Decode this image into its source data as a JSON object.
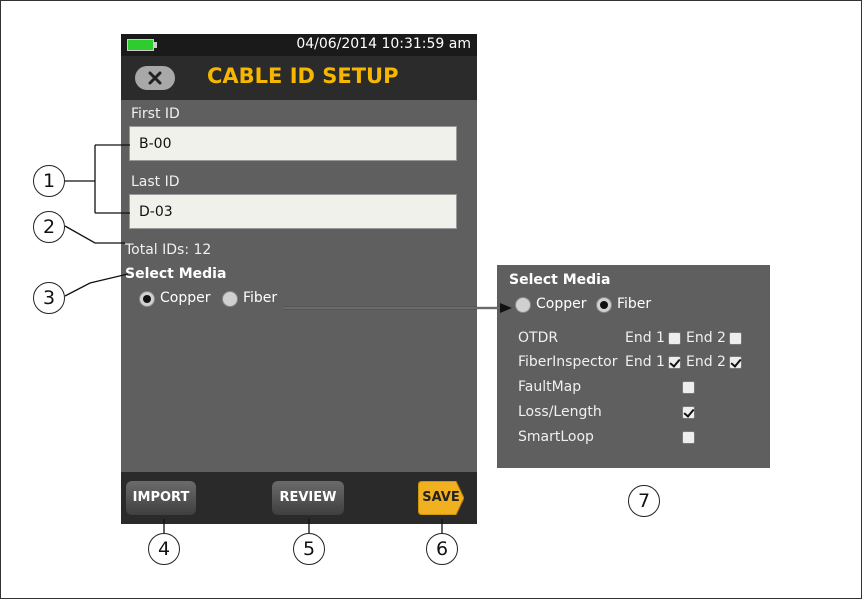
{
  "device": {
    "datetime": "04/06/2014 10:31:59 am",
    "title": "CABLE ID SETUP",
    "first_id_label": "First ID",
    "first_id_value": "B-00",
    "last_id_label": "Last ID",
    "last_id_value": "D-03",
    "total_ids": "Total IDs: 12",
    "select_media_label": "Select Media",
    "media_options": [
      {
        "label": "Copper",
        "selected": true
      },
      {
        "label": "Fiber",
        "selected": false
      }
    ],
    "buttons": {
      "import": "IMPORT",
      "review": "REVIEW",
      "save": "SAVE"
    },
    "battery_color": "#2ecc2e",
    "title_color": "#f5b700",
    "save_color": "#f0b020"
  },
  "panel": {
    "select_media_label": "Select Media",
    "media_options": [
      {
        "label": "Copper",
        "selected": false
      },
      {
        "label": "Fiber",
        "selected": true
      }
    ],
    "rows": [
      {
        "label": "OTDR",
        "end1_label": "End 1",
        "end1": false,
        "end2_label": "End 2",
        "end2": false
      },
      {
        "label": "FiberInspector",
        "end1_label": "End 1",
        "end1": true,
        "end2_label": "End 2",
        "end2": true
      },
      {
        "label": "FaultMap",
        "checked": false
      },
      {
        "label": "Loss/Length",
        "checked": true
      },
      {
        "label": "SmartLoop",
        "checked": false
      }
    ]
  },
  "callouts": [
    "1",
    "2",
    "3",
    "4",
    "5",
    "6",
    "7"
  ]
}
